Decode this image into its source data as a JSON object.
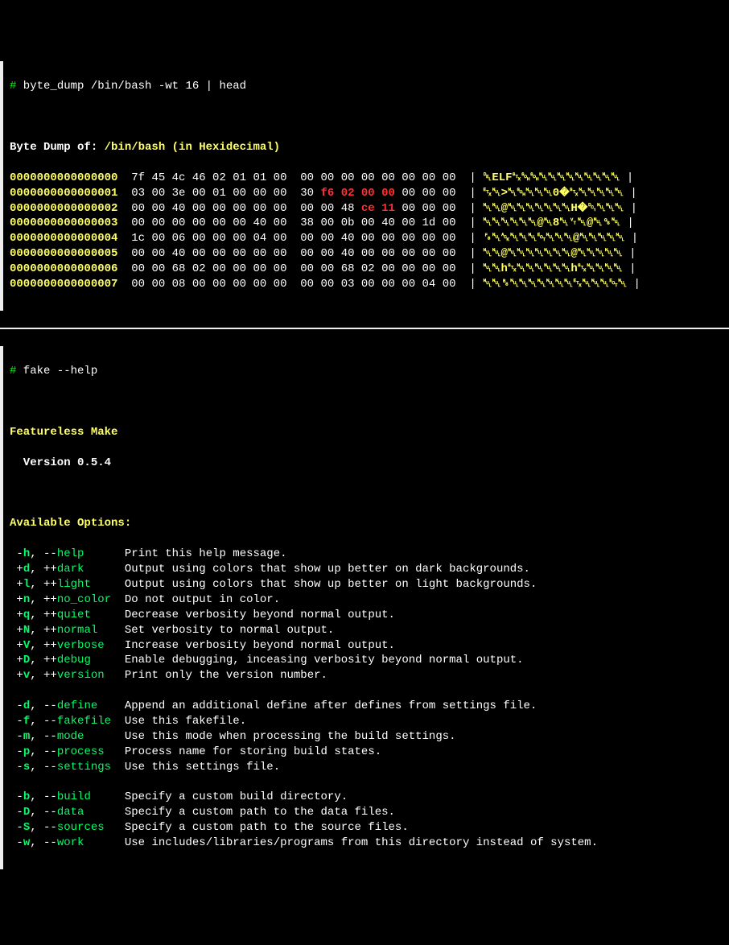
{
  "cmd1": {
    "prompt": "#",
    "cmdline": " byte_dump /bin/bash -wt 16 | head"
  },
  "dump": {
    "title1": "Byte Dump of: ",
    "title2": "/bin/bash (in Hexidecimal)",
    "rows": [
      {
        "addr": "0000000000000000",
        "hex_a": "7f 45 4c 46 02 01 01 00",
        "hex_b": "00 00 00 00 00 00 00 00",
        "hl_a": "",
        "hl_b": "",
        "ascii": "␡ELF␂␁␁␀␀␀␀␀␀␀␀␀"
      },
      {
        "addr": "0000000000000001",
        "hex_a": "03 00 3e 00 01 00 00 00",
        "hex_b_pre": "30 ",
        "hl_b": "f6 02 00 00",
        "hex_b_post": " 00 00 00",
        "ascii": "␃␀>␀␁␀␀␀0�␂␀␀␀␀␀"
      },
      {
        "addr": "0000000000000002",
        "hex_a": "00 00 40 00 00 00 00 00",
        "hex_b_pre": "00 00 48 ",
        "hl_b": "ce 11",
        "hex_b_post": " 00 00 00",
        "ascii": "␀␀@␀␀␀␀␀␀␀H�␑␀␀␀"
      },
      {
        "addr": "0000000000000003",
        "hex_a": "00 00 00 00 00 00 40 00",
        "hex_b": "38 00 0b 00 40 00 1d 00",
        "hl_a": "",
        "hl_b": "",
        "ascii": "␀␀␀␀␀␀@␀8␀␋␀@␀␝␀"
      },
      {
        "addr": "0000000000000004",
        "hex_a": "1c 00 06 00 00 00 04 00",
        "hex_b": "00 00 40 00 00 00 00 00",
        "hl_a": "",
        "hl_b": "",
        "ascii": "␜␀␆␀␀␀␄␀␀␀@␀␀␀␀␀"
      },
      {
        "addr": "0000000000000005",
        "hex_a": "00 00 40 00 00 00 00 00",
        "hex_b": "00 00 40 00 00 00 00 00",
        "hl_a": "",
        "hl_b": "",
        "ascii": "␀␀@␀␀␀␀␀␀␀@␀␀␀␀␀"
      },
      {
        "addr": "0000000000000006",
        "hex_a": "00 00 68 02 00 00 00 00",
        "hex_b": "00 00 68 02 00 00 00 00",
        "hl_a": "",
        "hl_b": "",
        "ascii": "␀␀h␂␀␀␀␀␀␀h␂␀␀␀␀"
      },
      {
        "addr": "0000000000000007",
        "hex_a": "00 00 08 00 00 00 00 00",
        "hex_b": "00 00 03 00 00 00 04 00",
        "hl_a": "",
        "hl_b": "",
        "ascii": "␀␀␈␀␀␀␀␀␀␀␃␀␀␀␄␀"
      }
    ]
  },
  "cmd2": {
    "prompt": "#",
    "cmdline": " fake --help"
  },
  "help": {
    "title": "Featureless Make",
    "version": "  Version 0.5.4",
    "avail": "Available Options:",
    "groups": [
      [
        {
          "d": "-",
          "s": "h",
          "p": "--",
          "l": "help    ",
          "desc": "Print this help message."
        },
        {
          "d": "+",
          "s": "d",
          "p": "++",
          "l": "dark    ",
          "desc": "Output using colors that show up better on dark backgrounds."
        },
        {
          "d": "+",
          "s": "l",
          "p": "++",
          "l": "light   ",
          "desc": "Output using colors that show up better on light backgrounds."
        },
        {
          "d": "+",
          "s": "n",
          "p": "++",
          "l": "no_color",
          "desc": "Do not output in color."
        },
        {
          "d": "+",
          "s": "q",
          "p": "++",
          "l": "quiet   ",
          "desc": "Decrease verbosity beyond normal output."
        },
        {
          "d": "+",
          "s": "N",
          "p": "++",
          "l": "normal  ",
          "desc": "Set verbosity to normal output."
        },
        {
          "d": "+",
          "s": "V",
          "p": "++",
          "l": "verbose ",
          "desc": "Increase verbosity beyond normal output."
        },
        {
          "d": "+",
          "s": "D",
          "p": "++",
          "l": "debug   ",
          "desc": "Enable debugging, inceasing verbosity beyond normal output."
        },
        {
          "d": "+",
          "s": "v",
          "p": "++",
          "l": "version ",
          "desc": "Print only the version number."
        }
      ],
      [
        {
          "d": "-",
          "s": "d",
          "p": "--",
          "l": "define  ",
          "desc": "Append an additional define after defines from settings file."
        },
        {
          "d": "-",
          "s": "f",
          "p": "--",
          "l": "fakefile",
          "desc": "Use this fakefile."
        },
        {
          "d": "-",
          "s": "m",
          "p": "--",
          "l": "mode    ",
          "desc": "Use this mode when processing the build settings."
        },
        {
          "d": "-",
          "s": "p",
          "p": "--",
          "l": "process ",
          "desc": "Process name for storing build states."
        },
        {
          "d": "-",
          "s": "s",
          "p": "--",
          "l": "settings",
          "desc": "Use this settings file."
        }
      ],
      [
        {
          "d": "-",
          "s": "b",
          "p": "--",
          "l": "build   ",
          "desc": "Specify a custom build directory."
        },
        {
          "d": "-",
          "s": "D",
          "p": "--",
          "l": "data    ",
          "desc": "Specify a custom path to the data files."
        },
        {
          "d": "-",
          "s": "S",
          "p": "--",
          "l": "sources ",
          "desc": "Specify a custom path to the source files."
        },
        {
          "d": "-",
          "s": "w",
          "p": "--",
          "l": "work    ",
          "desc": "Use includes/libraries/programs from this directory instead of system."
        }
      ]
    ]
  }
}
